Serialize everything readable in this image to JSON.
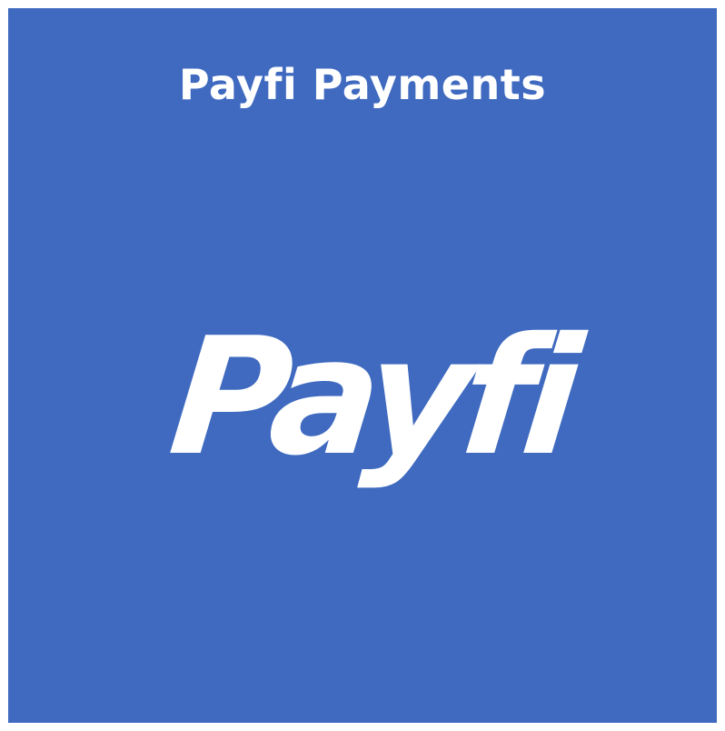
{
  "page": {
    "title": "Payfi Payments",
    "logo_text": "Payfi"
  },
  "colors": {
    "background": "#3F6AC0",
    "text": "#FFFFFF",
    "outer_border": "#FFFFFF"
  }
}
